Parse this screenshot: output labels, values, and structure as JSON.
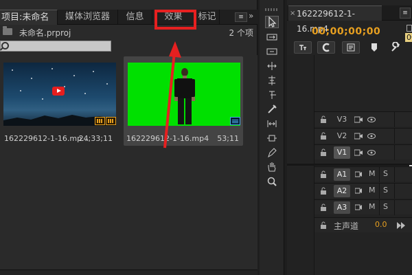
{
  "project_panel": {
    "tabs": [
      {
        "label": "项目:未命名"
      },
      {
        "label": "媒体浏览器"
      },
      {
        "label": "信息"
      },
      {
        "label": "效果"
      },
      {
        "label": "标记"
      }
    ],
    "menu_icon": "≡",
    "overflow_icon": "»",
    "filename": "未命名.prproj",
    "item_count": "2 个项",
    "search": {
      "value": "",
      "placeholder": ""
    },
    "clips": [
      {
        "name": "162229612-1-16.mp...",
        "duration": "24;33;11"
      },
      {
        "name": "162229612-1-16.mp4",
        "duration": "53;11"
      }
    ]
  },
  "timeline_panel": {
    "sequence_tab": "162229612-1-16.mp4",
    "close_icon": "×",
    "menu_icon": "≡",
    "timecode": "00;00;00;00",
    "ruler_label": "00",
    "tracks": {
      "video": [
        {
          "label": "V3",
          "targeted": false
        },
        {
          "label": "V2",
          "targeted": false
        },
        {
          "label": "V1",
          "targeted": true
        }
      ],
      "audio": [
        {
          "label": "A1",
          "m": "M",
          "s": "S"
        },
        {
          "label": "A2",
          "m": "M",
          "s": "S"
        },
        {
          "label": "A3",
          "m": "M",
          "s": "S"
        }
      ],
      "master": {
        "label": "主声道",
        "value": "0.0"
      }
    }
  },
  "annotation": {
    "highlight_color": "#e62020",
    "target": "效果"
  },
  "colors": {
    "timecode": "#e8a020",
    "green_screen": "#00e000",
    "accent_red": "#e62020"
  }
}
